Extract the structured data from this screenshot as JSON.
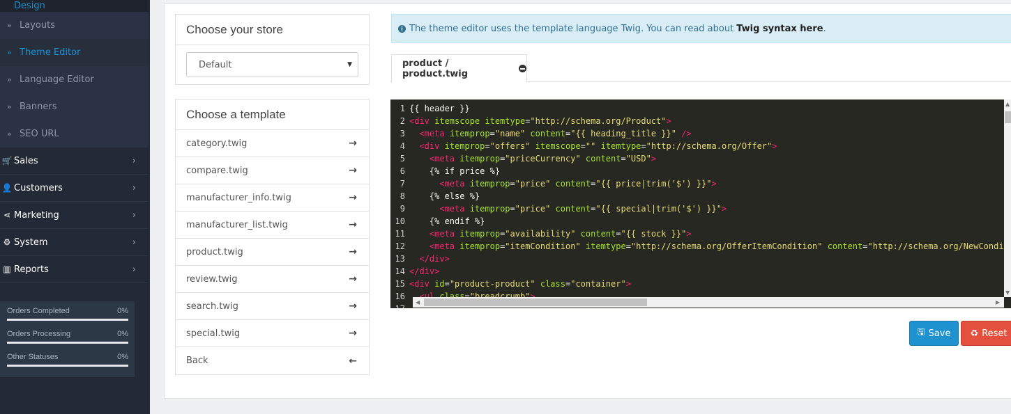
{
  "sidebar": {
    "design_label": "Design",
    "sub_items": [
      {
        "label": "Layouts",
        "active": false
      },
      {
        "label": "Theme Editor",
        "active": true
      },
      {
        "label": "Language Editor",
        "active": false
      },
      {
        "label": "Banners",
        "active": false
      },
      {
        "label": "SEO URL",
        "active": false
      }
    ],
    "top_items": [
      {
        "label": "Sales",
        "icon": "shopping-cart-icon"
      },
      {
        "label": "Customers",
        "icon": "user-icon"
      },
      {
        "label": "Marketing",
        "icon": "share-icon"
      },
      {
        "label": "System",
        "icon": "cog-icon"
      },
      {
        "label": "Reports",
        "icon": "bar-chart-icon"
      }
    ],
    "stats": [
      {
        "label": "Orders Completed",
        "value": "0%",
        "progress": 0
      },
      {
        "label": "Orders Processing",
        "value": "0%",
        "progress": 0
      },
      {
        "label": "Other Statuses",
        "value": "0%",
        "progress": 0
      }
    ]
  },
  "store": {
    "title": "Choose your store",
    "selected": "Default"
  },
  "templates": {
    "title": "Choose a template",
    "items": [
      "category.twig",
      "compare.twig",
      "manufacturer_info.twig",
      "manufacturer_list.twig",
      "product.twig",
      "review.twig",
      "search.twig",
      "special.twig"
    ],
    "back_label": "Back"
  },
  "alert": {
    "text": "The theme editor uses the template language Twig. You can read about",
    "link": "Twig syntax here",
    "suffix": "."
  },
  "tab": {
    "label": "product / product.twig"
  },
  "editor": {
    "theme_colors": {
      "background": "#272822",
      "tag": "#f92672",
      "attr": "#a6e22e",
      "string": "#e6db74",
      "plain": "#f8f8f2"
    },
    "lines": [
      [
        [
          "plain",
          "{{ header }}"
        ]
      ],
      [
        [
          "tag",
          "<div "
        ],
        [
          "attr",
          "itemscope itemtype"
        ],
        [
          "plain",
          "="
        ],
        [
          "str",
          "\"http://schema.org/Product\""
        ],
        [
          "tag",
          ">"
        ]
      ],
      [
        [
          "plain",
          "  "
        ],
        [
          "tag",
          "<meta "
        ],
        [
          "attr",
          "itemprop"
        ],
        [
          "plain",
          "="
        ],
        [
          "str",
          "\"name\" "
        ],
        [
          "attr",
          "content"
        ],
        [
          "plain",
          "="
        ],
        [
          "str",
          "\"{{ heading_title }}\" "
        ],
        [
          "tag",
          "/>"
        ]
      ],
      [
        [
          "plain",
          "  "
        ],
        [
          "tag",
          "<div "
        ],
        [
          "attr",
          "itemprop"
        ],
        [
          "plain",
          "="
        ],
        [
          "str",
          "\"offers\" "
        ],
        [
          "attr",
          "itemscope"
        ],
        [
          "plain",
          "="
        ],
        [
          "str",
          "\"\" "
        ],
        [
          "attr",
          "itemtype"
        ],
        [
          "plain",
          "="
        ],
        [
          "str",
          "\"http://schema.org/Offer\""
        ],
        [
          "tag",
          ">"
        ]
      ],
      [
        [
          "plain",
          "    "
        ],
        [
          "tag",
          "<meta "
        ],
        [
          "attr",
          "itemprop"
        ],
        [
          "plain",
          "="
        ],
        [
          "str",
          "\"priceCurrency\" "
        ],
        [
          "attr",
          "content"
        ],
        [
          "plain",
          "="
        ],
        [
          "str",
          "\"USD\""
        ],
        [
          "tag",
          ">"
        ]
      ],
      [
        [
          "plain",
          "    {% if price %}"
        ]
      ],
      [
        [
          "plain",
          "      "
        ],
        [
          "tag",
          "<meta "
        ],
        [
          "attr",
          "itemprop"
        ],
        [
          "plain",
          "="
        ],
        [
          "str",
          "\"price\" "
        ],
        [
          "attr",
          "content"
        ],
        [
          "plain",
          "="
        ],
        [
          "str",
          "\"{{ price|trim('$') }}\""
        ],
        [
          "tag",
          ">"
        ]
      ],
      [
        [
          "plain",
          "    {% else %}"
        ]
      ],
      [
        [
          "plain",
          "      "
        ],
        [
          "tag",
          "<meta "
        ],
        [
          "attr",
          "itemprop"
        ],
        [
          "plain",
          "="
        ],
        [
          "str",
          "\"price\" "
        ],
        [
          "attr",
          "content"
        ],
        [
          "plain",
          "="
        ],
        [
          "str",
          "\"{{ special|trim('$') }}\""
        ],
        [
          "tag",
          ">"
        ]
      ],
      [
        [
          "plain",
          "    {% endif %}"
        ]
      ],
      [
        [
          "plain",
          "    "
        ],
        [
          "tag",
          "<meta "
        ],
        [
          "attr",
          "itemprop"
        ],
        [
          "plain",
          "="
        ],
        [
          "str",
          "\"availability\" "
        ],
        [
          "attr",
          "content"
        ],
        [
          "plain",
          "="
        ],
        [
          "str",
          "\"{{ stock }}\""
        ],
        [
          "tag",
          ">"
        ]
      ],
      [
        [
          "plain",
          "    "
        ],
        [
          "tag",
          "<meta "
        ],
        [
          "attr",
          "itemprop"
        ],
        [
          "plain",
          "="
        ],
        [
          "str",
          "\"itemCondition\" "
        ],
        [
          "attr",
          "itemtype"
        ],
        [
          "plain",
          "="
        ],
        [
          "str",
          "\"http://schema.org/OfferItemCondition\" "
        ],
        [
          "attr",
          "content"
        ],
        [
          "plain",
          "="
        ],
        [
          "str",
          "\"http://schema.org/NewCondition\""
        ],
        [
          "tag",
          ">"
        ]
      ],
      [
        [
          "plain",
          "  "
        ],
        [
          "tag",
          "</div>"
        ]
      ],
      [
        [
          "tag",
          "</div>"
        ]
      ],
      [
        [
          "tag",
          "<div "
        ],
        [
          "attr",
          "id"
        ],
        [
          "plain",
          "="
        ],
        [
          "str",
          "\"product-product\" "
        ],
        [
          "attr",
          "class"
        ],
        [
          "plain",
          "="
        ],
        [
          "str",
          "\"container\""
        ],
        [
          "tag",
          ">"
        ]
      ],
      [
        [
          "plain",
          "  "
        ],
        [
          "tag",
          "<ul "
        ],
        [
          "attr",
          "class"
        ],
        [
          "plain",
          "="
        ],
        [
          "str",
          "\"breadcrumb\""
        ],
        [
          "tag",
          ">"
        ]
      ],
      [
        [
          "plain",
          ""
        ]
      ]
    ]
  },
  "buttons": {
    "save": "Save",
    "reset": "Reset"
  }
}
